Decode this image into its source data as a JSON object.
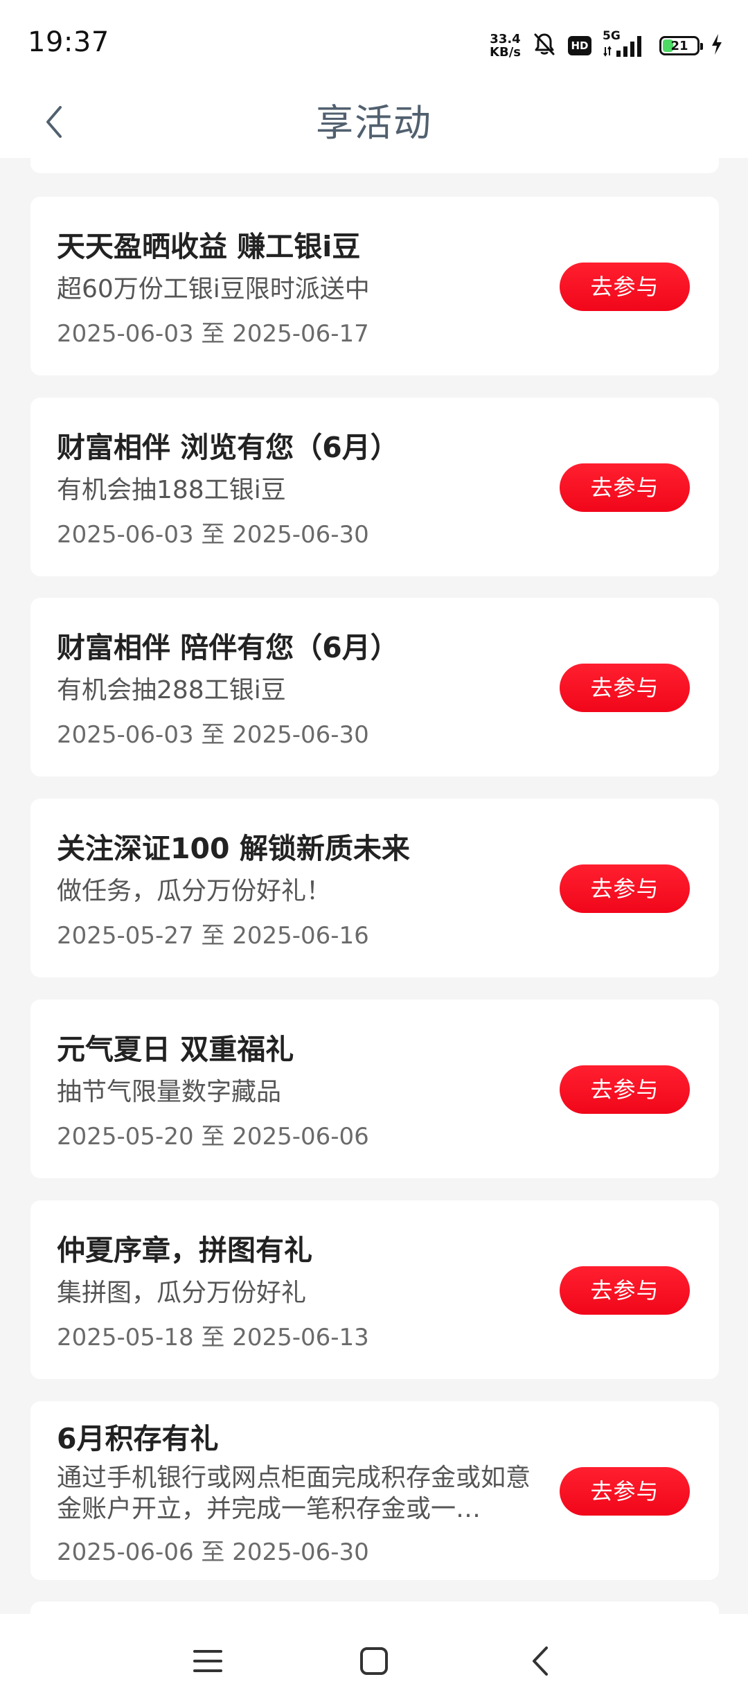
{
  "status_bar": {
    "time": "19:37",
    "net_speed_value": "33.4",
    "net_speed_unit": "KB/s",
    "hd_badge": "HD",
    "network_type": "5G",
    "battery_level": "21"
  },
  "header": {
    "title": "享活动"
  },
  "activities": [
    {
      "title": "天天盈晒收益 赚工银i豆",
      "description": "超60万份工银i豆限时派送中",
      "date_range": "2025-06-03 至 2025-06-17",
      "button_label": "去参与"
    },
    {
      "title": "财富相伴 浏览有您（6月）",
      "description": "有机会抽188工银i豆",
      "date_range": "2025-06-03 至 2025-06-30",
      "button_label": "去参与"
    },
    {
      "title": "财富相伴 陪伴有您（6月）",
      "description": "有机会抽288工银i豆",
      "date_range": "2025-06-03 至 2025-06-30",
      "button_label": "去参与"
    },
    {
      "title": "关注深证100 解锁新质未来",
      "description": "做任务，瓜分万份好礼！",
      "date_range": "2025-05-27 至 2025-06-16",
      "button_label": "去参与"
    },
    {
      "title": "元气夏日 双重福礼",
      "description": "抽节气限量数字藏品",
      "date_range": "2025-05-20 至 2025-06-06",
      "button_label": "去参与"
    },
    {
      "title": "仲夏序章，拼图有礼",
      "description": "集拼图，瓜分万份好礼",
      "date_range": "2025-05-18 至 2025-06-13",
      "button_label": "去参与"
    },
    {
      "title": "6月积存有礼",
      "description": "通过手机银行或网点柜面完成积存金或如意金账户开立，并完成一笔积存金或一…",
      "date_range": "2025-06-06 至 2025-06-30",
      "button_label": "去参与"
    }
  ],
  "colors": {
    "accent": "#f1061a",
    "page_background": "#f5f5f5",
    "title_color": "#51606f"
  },
  "icons": {
    "back": "chevron-left-icon",
    "menu": "menu-icon",
    "home": "square-home-icon",
    "nav_back": "chevron-left-icon"
  }
}
